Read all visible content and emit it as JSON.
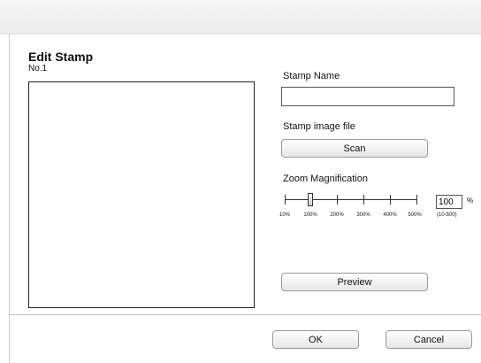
{
  "dialog": {
    "title": "Edit Stamp",
    "stamp_number": "No.1"
  },
  "stamp_name": {
    "label": "Stamp Name",
    "value": ""
  },
  "stamp_image": {
    "label": "Stamp image file",
    "scan_label": "Scan"
  },
  "zoom": {
    "label": "Zoom Magnification",
    "value": "100",
    "unit": "%",
    "range": "(10-500)",
    "slider_value_percent": 100,
    "tick_labels": [
      "10%",
      "100%",
      "200%",
      "300%",
      "400%",
      "500%"
    ]
  },
  "preview_label": "Preview",
  "footer": {
    "ok_label": "OK",
    "cancel_label": "Cancel"
  }
}
